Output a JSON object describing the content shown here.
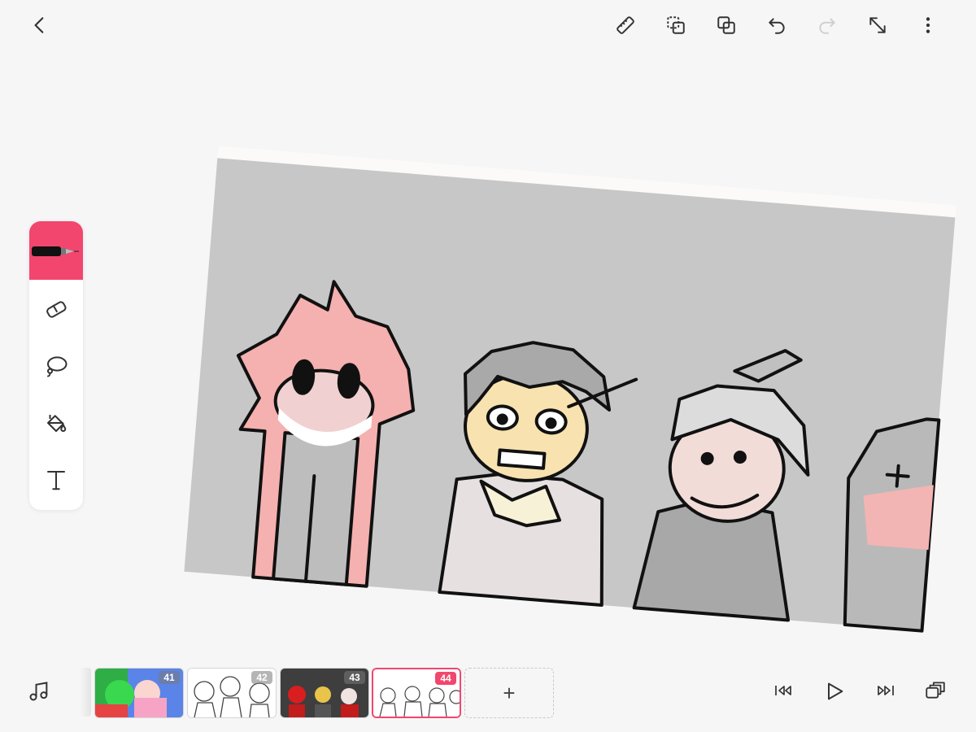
{
  "toolbar": {
    "back_icon": "chevron-left-icon",
    "ruler_icon": "ruler-icon",
    "layer_select_icon": "dashed-copy-icon",
    "duplicate_icon": "duplicate-icon",
    "undo_icon": "undo-icon",
    "redo_icon": "redo-icon",
    "redo_enabled": false,
    "fullscreen_icon": "expand-icon",
    "more_icon": "more-vertical-icon"
  },
  "tools": [
    {
      "name": "pen",
      "icon": "pen-icon",
      "active": true
    },
    {
      "name": "eraser",
      "icon": "eraser-icon",
      "active": false
    },
    {
      "name": "lasso",
      "icon": "lasso-icon",
      "active": false
    },
    {
      "name": "fill",
      "icon": "paint-bucket-icon",
      "active": false
    },
    {
      "name": "text",
      "icon": "text-icon",
      "active": false
    }
  ],
  "accent_color": "#f2466e",
  "timeline": {
    "frames": [
      {
        "number": "41"
      },
      {
        "number": "42"
      },
      {
        "number": "43"
      },
      {
        "number": "44",
        "selected": true
      }
    ],
    "add_label": "+",
    "music_icon": "music-note-icon",
    "first_frame_icon": "skip-back-icon",
    "play_icon": "play-icon",
    "last_frame_icon": "skip-forward-icon",
    "onion_skin_icon": "onion-layers-icon"
  }
}
